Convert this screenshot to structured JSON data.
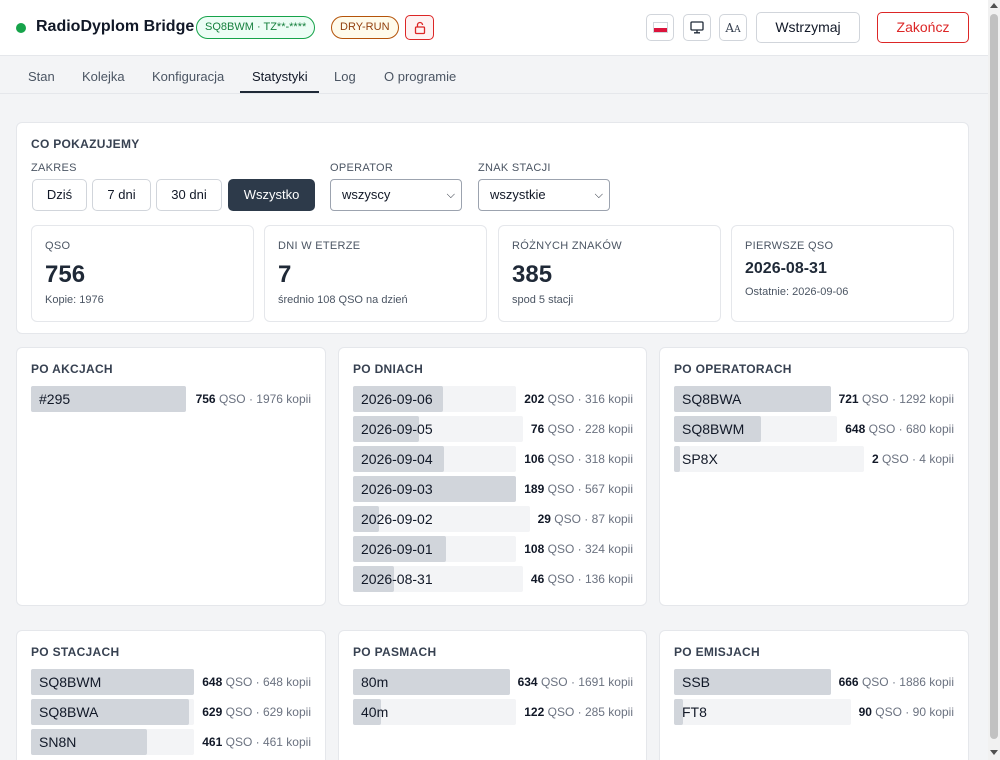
{
  "app": {
    "title": "RadioDyplom Bridge",
    "callsign_badge": "SQ8BWM · TZ**-****",
    "mode_badge": "DRY-RUN",
    "pause_label": "Wstrzymaj",
    "quit_label": "Zakończ",
    "status_color": "#16a34a",
    "icons": [
      "lock-icon",
      "polish-flag-icon",
      "monitor-icon",
      "font-size-icon"
    ]
  },
  "tabs": [
    {
      "label": "Stan",
      "active": false
    },
    {
      "label": "Kolejka",
      "active": false
    },
    {
      "label": "Konfiguracja",
      "active": false
    },
    {
      "label": "Statystyki",
      "active": true
    },
    {
      "label": "Log",
      "active": false
    },
    {
      "label": "O programie",
      "active": false
    }
  ],
  "filters": {
    "title": "CO POKAZUJEMY",
    "range_label": "ZAKRES",
    "range_options": [
      "Dziś",
      "7 dni",
      "30 dni",
      "Wszystko"
    ],
    "range_selected": "Wszystko",
    "operator_label": "OPERATOR",
    "operator_value": "wszyscy",
    "station_label": "ZNAK STACJI",
    "station_value": "wszystkie"
  },
  "summary": [
    {
      "label": "QSO",
      "value": "756",
      "sub": "Kopie: 1976"
    },
    {
      "label": "DNI W ETERZE",
      "value": "7",
      "sub": "średnio 108 QSO na dzień"
    },
    {
      "label": "RÓŻNYCH ZNAKÓW",
      "value": "385",
      "sub": "spod 5 stacji"
    },
    {
      "label": "PIERWSZE QSO",
      "value": "2026-08-31",
      "sub": "Ostatnie: 2026-09-06"
    }
  ],
  "units": {
    "qso": "QSO",
    "copies": "kopii"
  },
  "panels": {
    "actions": {
      "title": "PO AKCJACH",
      "rows": [
        {
          "name": "#295",
          "qso": 756,
          "copies": 1976,
          "fill": 1.0
        }
      ]
    },
    "days": {
      "title": "PO DNIACH",
      "rows": [
        {
          "name": "2026-09-06",
          "qso": 202,
          "copies": 316,
          "fill": 0.55
        },
        {
          "name": "2026-09-05",
          "qso": 76,
          "copies": 228,
          "fill": 0.39
        },
        {
          "name": "2026-09-04",
          "qso": 106,
          "copies": 318,
          "fill": 0.56
        },
        {
          "name": "2026-09-03",
          "qso": 189,
          "copies": 567,
          "fill": 1.0
        },
        {
          "name": "2026-09-02",
          "qso": 29,
          "copies": 87,
          "fill": 0.15
        },
        {
          "name": "2026-09-01",
          "qso": 108,
          "copies": 324,
          "fill": 0.57
        },
        {
          "name": "2026-08-31",
          "qso": 46,
          "copies": 136,
          "fill": 0.24
        }
      ]
    },
    "operators": {
      "title": "PO OPERATORACH",
      "rows": [
        {
          "name": "SQ8BWA",
          "qso": 721,
          "copies": 1292,
          "fill": 1.0
        },
        {
          "name": "SQ8BWM",
          "qso": 648,
          "copies": 680,
          "fill": 0.53
        },
        {
          "name": "SP8X",
          "qso": 2,
          "copies": 4,
          "fill": 0.01
        }
      ]
    },
    "stations": {
      "title": "PO STACJACH",
      "rows": [
        {
          "name": "SQ8BWM",
          "qso": 648,
          "copies": 648,
          "fill": 1.0
        },
        {
          "name": "SQ8BWA",
          "qso": 629,
          "copies": 629,
          "fill": 0.97
        },
        {
          "name": "SN8N",
          "qso": 461,
          "copies": 461,
          "fill": 0.71
        }
      ]
    },
    "bands": {
      "title": "PO PASMACH",
      "rows": [
        {
          "name": "80m",
          "qso": 634,
          "copies": 1691,
          "fill": 1.0
        },
        {
          "name": "40m",
          "qso": 122,
          "copies": 285,
          "fill": 0.17
        }
      ]
    },
    "modes": {
      "title": "PO EMISJACH",
      "rows": [
        {
          "name": "SSB",
          "qso": 666,
          "copies": 1886,
          "fill": 1.0
        },
        {
          "name": "FT8",
          "qso": 90,
          "copies": 90,
          "fill": 0.05
        }
      ]
    }
  }
}
